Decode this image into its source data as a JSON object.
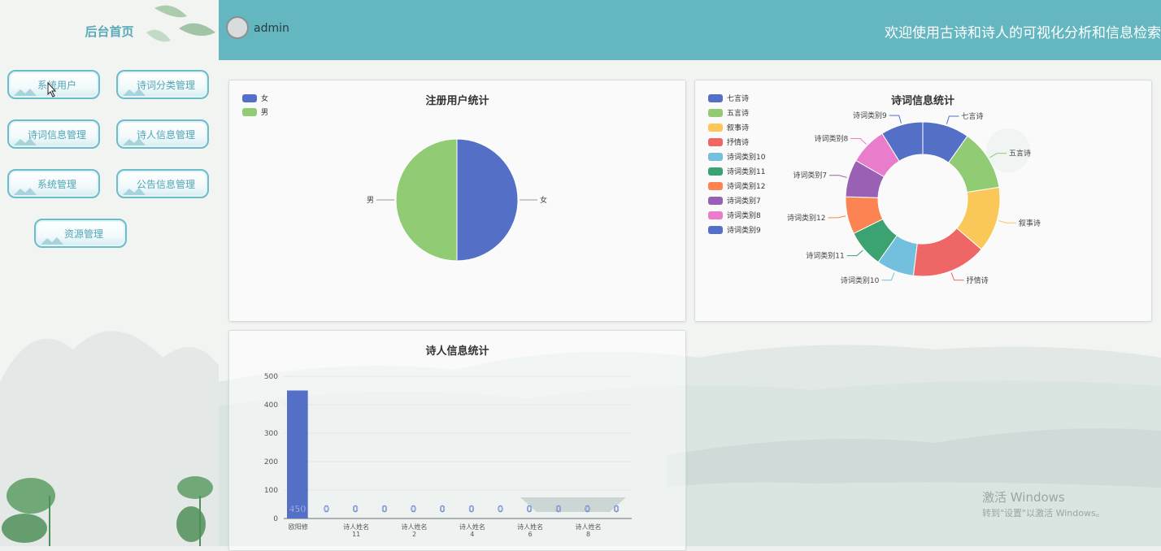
{
  "sidebar": {
    "title": "后台首页",
    "items": [
      {
        "label": "系统用户"
      },
      {
        "label": "诗词分类管理"
      },
      {
        "label": "诗词信息管理"
      },
      {
        "label": "诗人信息管理"
      },
      {
        "label": "系统管理"
      },
      {
        "label": "公告信息管理"
      },
      {
        "label": "资源管理"
      }
    ]
  },
  "header": {
    "username": "admin",
    "welcome": "欢迎使用古诗和诗人的可视化分析和信息检索"
  },
  "colors": {
    "header_bg": "#64b7c1",
    "accent": "#5aa9b8",
    "palette": [
      "#5470c6",
      "#91cc75",
      "#fac858",
      "#ee6666",
      "#73c0de",
      "#3ba272",
      "#fc8452",
      "#9a60b4",
      "#ea7ccc"
    ]
  },
  "charts": {
    "users": {
      "title": "注册用户统计",
      "legend": [
        "女",
        "男"
      ]
    },
    "poems": {
      "title": "诗词信息统计",
      "legend": [
        "七言诗",
        "五言诗",
        "叙事诗",
        "抒情诗",
        "诗词类别10",
        "诗词类别11",
        "诗词类别12",
        "诗词类别7",
        "诗词类别8",
        "诗词类别9"
      ]
    },
    "poets": {
      "title": "诗人信息统计",
      "yticks": [
        "500",
        "400",
        "300",
        "200",
        "100",
        "0"
      ],
      "xlabels": [
        {
          "line1": "欧阳修",
          "line2": ""
        },
        {
          "line1": "诗人姓名",
          "line2": "11"
        },
        {
          "line1": "诗人姓名",
          "line2": "2"
        },
        {
          "line1": "诗人姓名",
          "line2": "4"
        },
        {
          "line1": "诗人姓名",
          "line2": "6"
        },
        {
          "line1": "诗人姓名",
          "line2": "8"
        }
      ]
    }
  },
  "chart_data": [
    {
      "type": "pie",
      "title": "注册用户统计",
      "labels": [
        "女",
        "男"
      ],
      "values": [
        50,
        50
      ]
    },
    {
      "type": "pie",
      "title": "诗词信息统计",
      "donut": true,
      "labels": [
        "七言诗",
        "五言诗",
        "叙事诗",
        "抒情诗",
        "诗词类别10",
        "诗词类别11",
        "诗词类别12",
        "诗词类别7",
        "诗词类别8",
        "诗词类别9"
      ],
      "values": [
        10,
        13,
        14,
        16,
        8,
        8,
        8,
        8,
        8,
        9
      ]
    },
    {
      "type": "bar",
      "title": "诗人信息统计",
      "values": [
        450,
        0,
        0,
        0,
        0,
        0,
        0,
        0,
        0,
        0,
        0,
        0
      ],
      "data_labels": [
        "450",
        "0",
        "0",
        "0",
        "0",
        "0",
        "0",
        "0",
        "0",
        "0",
        "0",
        "0"
      ],
      "ylim": [
        0,
        500
      ]
    }
  ],
  "system": {
    "watermark_line1": "激活 Windows",
    "watermark_line2": "转到\"设置\"以激活 Windows。"
  }
}
